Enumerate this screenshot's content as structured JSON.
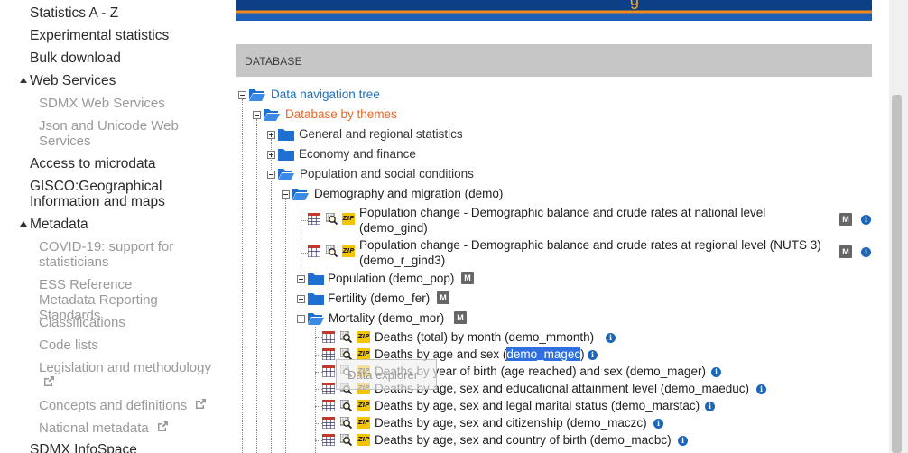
{
  "banner": {
    "text": "g"
  },
  "sidebar": {
    "items": [
      {
        "label": "Statistics A - Z",
        "type": "link"
      },
      {
        "label": "Experimental statistics",
        "type": "link"
      },
      {
        "label": "Bulk download",
        "type": "link"
      },
      {
        "label": "Web Services",
        "type": "group"
      },
      {
        "label": "SDMX Web Services",
        "type": "sub"
      },
      {
        "label": "Json and Unicode Web Services",
        "type": "sub"
      },
      {
        "label": "Access to microdata",
        "type": "link"
      },
      {
        "label": "GISCO:Geographical Information and maps",
        "type": "link"
      },
      {
        "label": "Metadata",
        "type": "group"
      },
      {
        "label": "COVID-19: support for statisticians",
        "type": "sub"
      },
      {
        "label": "ESS Reference Metadata Reporting Standards",
        "type": "sub"
      },
      {
        "label": "Classifications",
        "type": "sub"
      },
      {
        "label": "Code lists",
        "type": "sub"
      },
      {
        "label": "Legislation and methodology",
        "type": "sub"
      },
      {
        "label": "Concepts and definitions",
        "type": "sub"
      },
      {
        "label": "National metadata",
        "type": "sub"
      },
      {
        "label": "SDMX InfoSpace",
        "type": "link"
      }
    ]
  },
  "main": {
    "section_title": "DATABASE",
    "tree": {
      "root": "Data navigation tree",
      "themes": "Database by themes",
      "general": "General and regional statistics",
      "economy": "Economy and finance",
      "population": "Population and social conditions",
      "demo": "Demography and migration (demo)",
      "gind_line1": "Population change - Demographic balance and crude rates at national level",
      "gind_line2": "(demo_gind)",
      "rgind_line1": "Population change - Demographic balance and crude rates at regional level (NUTS 3)",
      "rgind_line2": "(demo_r_gind3)",
      "pop": "Population (demo_pop)",
      "fer": "Fertility (demo_fer)",
      "mor": "Mortality (demo_mor)",
      "mmonth": "Deaths (total) by month (demo_mmonth)",
      "magec_pre": "Deaths by age and sex (",
      "magec_sel": "demo_magec",
      "magec_post": ")",
      "mager": "Deaths by year of birth (age reached) and sex (demo_mager)",
      "maeduc": "Deaths by age, sex and educational attainment level (demo_maeduc)",
      "marstac": "Deaths by age, sex and legal marital status (demo_marstac)",
      "maczc": "Deaths by age, sex and citizenship (demo_maczc)",
      "macbc": "Deaths by age, sex and country of birth (demo_macbc)"
    },
    "tooltip": "Data explorer",
    "icons": {
      "zip": "ZIP",
      "metadata": "M",
      "info": "i"
    }
  },
  "colors": {
    "link_blue": "#1a6fc1",
    "link_orange": "#e5682a",
    "folder_blue": "#1f6fd1",
    "zip_yellow": "#f5c400",
    "selection": "#2f6fdf"
  }
}
